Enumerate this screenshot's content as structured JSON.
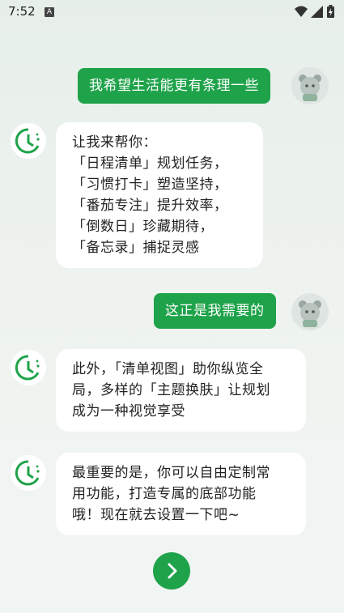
{
  "status_bar": {
    "time": "7:52",
    "notification_icon": "A",
    "icons": [
      "wifi-icon",
      "signal-icon",
      "battery-charging-icon"
    ]
  },
  "messages": [
    {
      "role": "user",
      "lines": [
        "我希望生活能更有条理一些"
      ]
    },
    {
      "role": "bot",
      "lines": [
        "让我来帮你：",
        "「日程清单」规划任务，",
        "「习惯打卡」塑造坚持，",
        "「番茄专注」提升效率，",
        "「倒数日」珍藏期待，",
        "「备忘录」捕捉灵感"
      ]
    },
    {
      "role": "user",
      "lines": [
        "这正是我需要的"
      ]
    },
    {
      "role": "bot",
      "lines": [
        "此外，「清单视图」助你纵览全",
        "局，多样的「主题换肤」让规划",
        "成为一种视觉享受"
      ]
    },
    {
      "role": "bot",
      "lines": [
        "最重要的是，你可以自由定制常",
        "用功能，打造专属的底部功能",
        "哦！现在就去设置一下吧~"
      ]
    }
  ],
  "next_button": {
    "icon": "chevron-right-icon"
  },
  "colors": {
    "accent": "#1fa34a",
    "background": "#eef3f0",
    "bubble_bot": "#ffffff"
  }
}
